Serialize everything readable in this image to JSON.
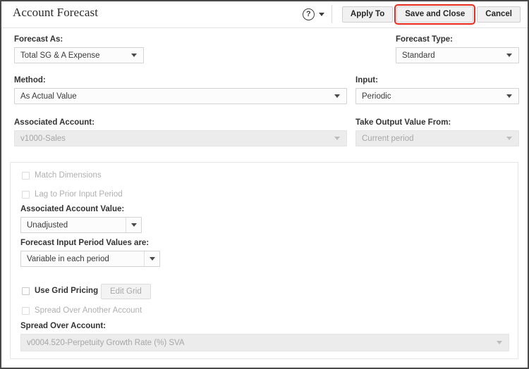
{
  "header": {
    "title": "Account Forecast",
    "help_icon": "help-circle-icon",
    "buttons": [
      {
        "label": "Apply To",
        "highlighted": false
      },
      {
        "label": "Save and Close",
        "highlighted": true
      },
      {
        "label": "Cancel",
        "highlighted": false
      }
    ],
    "highlight_color": "#e8291c"
  },
  "form": {
    "forecast_as": {
      "label": "Forecast As:",
      "value": "Total SG & A Expense",
      "disabled": false
    },
    "forecast_type": {
      "label": "Forecast Type:",
      "value": "Standard",
      "disabled": false
    },
    "method": {
      "label": "Method:",
      "value": "As Actual Value",
      "disabled": false
    },
    "input": {
      "label": "Input:",
      "value": "Periodic",
      "disabled": false
    },
    "associated_account": {
      "label": "Associated Account:",
      "value": "v1000-Sales",
      "disabled": true
    },
    "take_output_value_from": {
      "label": "Take Output Value From:",
      "value": "Current period",
      "disabled": true
    }
  },
  "panel": {
    "match_dimensions": {
      "label": "Match Dimensions",
      "checked": false,
      "disabled": true
    },
    "lag_to_prior_input_period": {
      "label": "Lag to Prior Input Period",
      "checked": false,
      "disabled": true
    },
    "associated_account_value": {
      "label": "Associated Account Value:",
      "value": "Unadjusted",
      "disabled": false
    },
    "forecast_input_period_values": {
      "label": "Forecast Input Period Values are:",
      "value": "Variable in each period",
      "disabled": false
    },
    "use_grid_pricing": {
      "label": "Use Grid Pricing",
      "checked": false,
      "disabled": false
    },
    "edit_grid_button": {
      "label": "Edit Grid",
      "disabled": true
    },
    "spread_over_another_account": {
      "label": "Spread Over Another Account",
      "checked": false,
      "disabled": true
    },
    "spread_over_account": {
      "label": "Spread Over Account:",
      "value": "v0004.520-Perpetuity Growth Rate (%) SVA",
      "disabled": true
    }
  }
}
